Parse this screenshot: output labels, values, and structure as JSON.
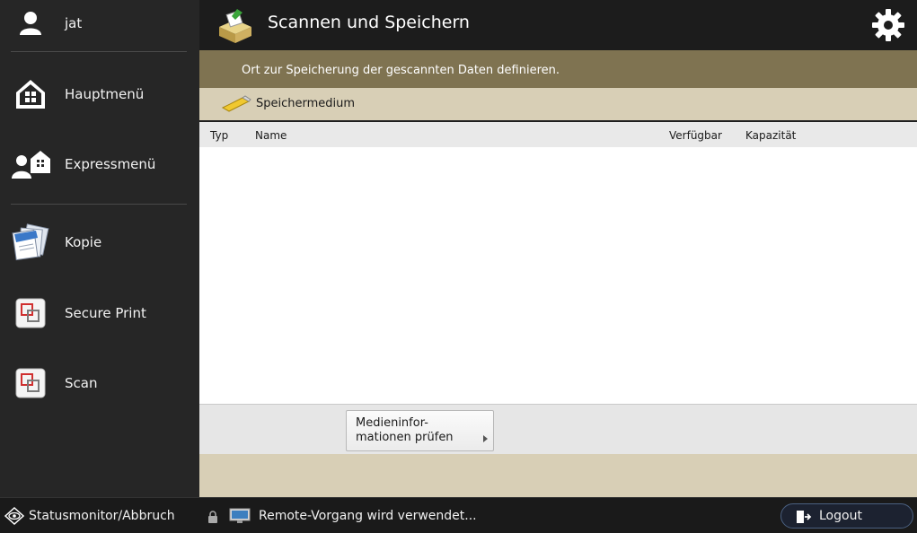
{
  "sidebar": {
    "user": {
      "label": "jat",
      "icon": "user-icon"
    },
    "items": [
      {
        "label": "Hauptmenü",
        "icon": "home-icon"
      },
      {
        "label": "Expressmenü",
        "icon": "express-menu-icon"
      },
      {
        "label": "Kopie",
        "icon": "copy-icon"
      },
      {
        "label": "Secure Print",
        "icon": "secure-print-icon"
      },
      {
        "label": "Scan",
        "icon": "scan-icon"
      }
    ]
  },
  "header": {
    "title": "Scannen und Speichern",
    "icon": "scan-and-store-icon",
    "settings_icon": "gear-icon"
  },
  "main": {
    "instruction": "Ort zur Speicherung der gescannten Daten definieren.",
    "section_label": "Speichermedium",
    "section_icon": "usb-memory-icon",
    "columns": {
      "type": "Typ",
      "name": "Name",
      "available": "Verfügbar",
      "capacity": "Kapazität"
    },
    "media_info_button": "Medieninfor-\nmationen prüfen"
  },
  "status": {
    "monitor_label": "Statusmonitor/Abbruch",
    "remote_message": "Remote-Vorgang wird verwendet...",
    "logout_label": "Logout"
  },
  "colors": {
    "sidebar_bg": "#262626",
    "instruction_bg": "#7f7351",
    "section_bg": "#d8cfb6",
    "header_bg": "#1c1c1c"
  }
}
